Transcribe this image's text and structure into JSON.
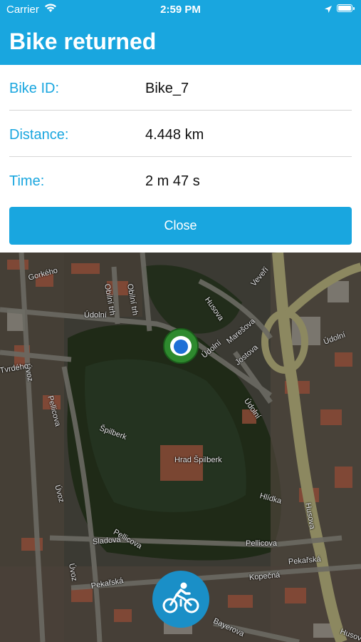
{
  "status_bar": {
    "carrier": "Carrier",
    "time": "2:59 PM",
    "icons": [
      "wifi-icon",
      "location-arrow-icon",
      "battery-icon"
    ]
  },
  "header": {
    "title": "Bike returned"
  },
  "details": [
    {
      "label": "Bike ID:",
      "value": "Bike_7"
    },
    {
      "label": "Distance:",
      "value": "4.448 km"
    },
    {
      "label": "Time:",
      "value": "2 m 47 s"
    }
  ],
  "close_button": {
    "label": "Close"
  },
  "map": {
    "street_labels": [
      "Gorkého",
      "Údolní",
      "Obilní trh",
      "Obilní trh",
      "Husova",
      "Veveří",
      "Údolní",
      "Marešova",
      "Jostova",
      "Údolní",
      "Údolní",
      "Úvoz",
      "Pellicova",
      "Tvrdého",
      "Špilberk",
      "Hrad Špilberk",
      "Úvoz",
      "Sladová",
      "Pellicova",
      "Pellicova",
      "Pekařská",
      "Kopečná",
      "Pekařská",
      "Husova",
      "Hlídka",
      "Bayerova",
      "Úvoz",
      "Husova"
    ]
  },
  "colors": {
    "accent": "#19a6df",
    "fab": "#1a8fc7",
    "marker": "#2e8a2e"
  },
  "fab": {
    "icon": "bicycle-rider-icon"
  }
}
